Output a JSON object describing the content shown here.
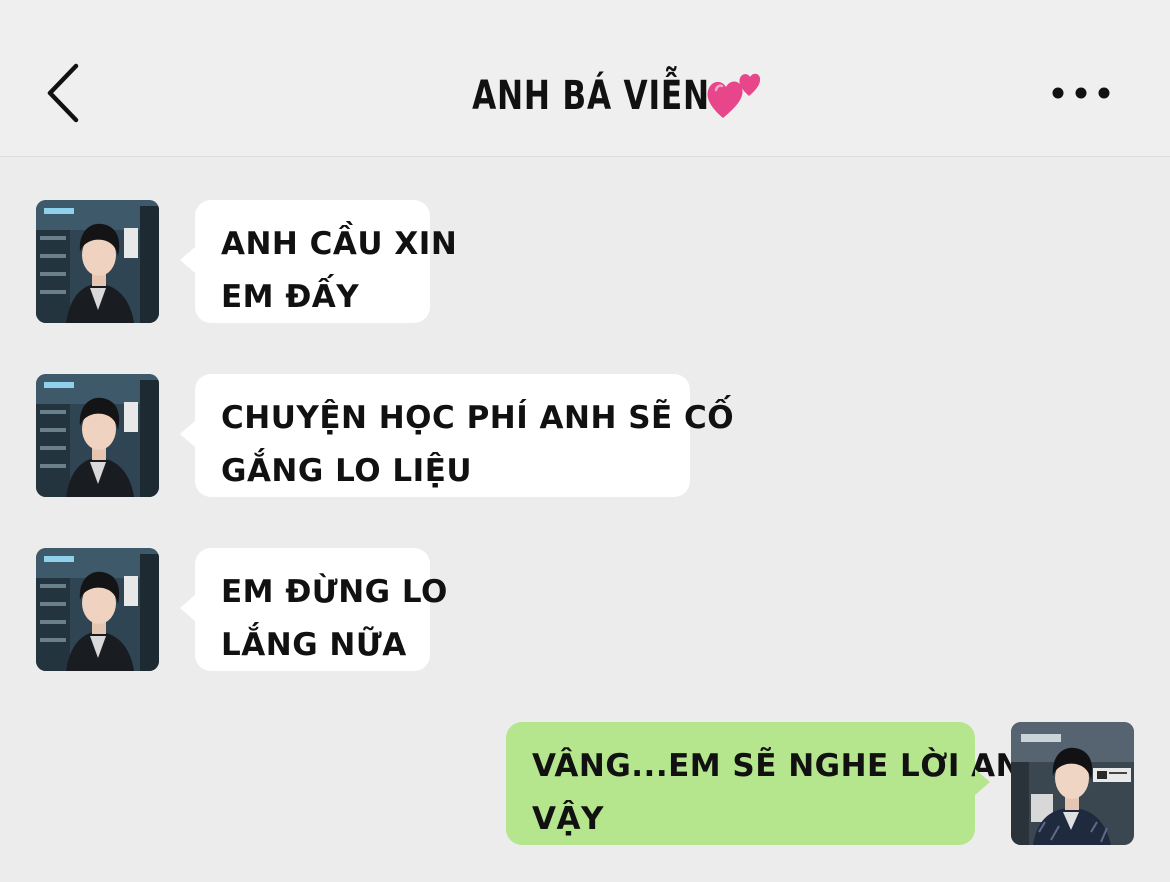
{
  "header": {
    "title": "ANH BÁ VIỄN",
    "back_icon": "chevron-left-icon",
    "title_emoji": "two-hearts-icon",
    "more_icon": "more-horizontal-icon"
  },
  "colors": {
    "background": "#ececec",
    "incoming_bubble": "#ffffff",
    "outgoing_bubble": "#b5e58c",
    "heart": "#e8468a"
  },
  "messages": [
    {
      "direction": "incoming",
      "lines": [
        "ANH CẦU XIN",
        "EM ĐẤY"
      ]
    },
    {
      "direction": "incoming",
      "lines": [
        "CHUYỆN HỌC PHÍ ANH SẼ CỐ",
        "GẮNG LO LIỆU"
      ]
    },
    {
      "direction": "incoming",
      "lines": [
        "EM ĐỪNG LO",
        "LẮNG NỮA"
      ]
    },
    {
      "direction": "outgoing",
      "lines": [
        "VÂNG...EM SẼ NGHE LỜI ANH",
        "VẬY"
      ]
    }
  ]
}
